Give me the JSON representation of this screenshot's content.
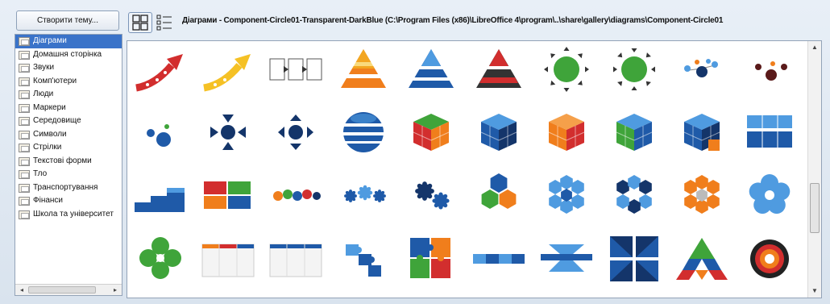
{
  "toolbar": {
    "create_theme_label": "Створити тему...",
    "path_text": "Діаграми - Component-Circle01-Transparent-DarkBlue (C:\\Program Files (x86)\\LibreOffice 4\\program\\..\\share\\gallery\\diagrams\\Component-Circle01"
  },
  "themes": [
    {
      "label": "Діаграми",
      "selected": true
    },
    {
      "label": "Домашня сторінка",
      "selected": false
    },
    {
      "label": "Звуки",
      "selected": false
    },
    {
      "label": "Комп'ютери",
      "selected": false
    },
    {
      "label": "Люди",
      "selected": false
    },
    {
      "label": "Маркери",
      "selected": false
    },
    {
      "label": "Середовище",
      "selected": false
    },
    {
      "label": "Символи",
      "selected": false
    },
    {
      "label": "Стрілки",
      "selected": false
    },
    {
      "label": "Текстові форми",
      "selected": false
    },
    {
      "label": "Тло",
      "selected": false
    },
    {
      "label": "Транспортування",
      "selected": false
    },
    {
      "label": "Фінанси",
      "selected": false
    },
    {
      "label": "Школа та університет",
      "selected": false
    }
  ],
  "gallery_items": [
    "arrow-red",
    "arrow-yellow",
    "process-boxes",
    "pyramid-orange",
    "pyramid-blue",
    "pyramid-red",
    "cycle-green-arrows-out",
    "cycle-green-arrows-in",
    "molecule-blue",
    "molecule-dark",
    "bubbles-blue",
    "cross-arrows-in",
    "cross-arrows-out",
    "sphere-stripes",
    "cube-multicolor",
    "cube-blue",
    "cube-orange",
    "cube-green",
    "cube-blue-stack",
    "blocks-blue",
    "steps-blue",
    "blocks-multicolor",
    "gears-chain",
    "gears-blue",
    "gears-pair",
    "hexagons-three",
    "hexagons-ring-blue",
    "hexagons-ring-navy",
    "hexagons-ring-orange",
    "petals-blue",
    "clover-green",
    "table-colored",
    "table-blue",
    "puzzle-blue",
    "puzzle-multicolor",
    "puzzle-chain",
    "crossing-blue",
    "square-blue",
    "triangle-multicolor",
    "target-circle"
  ],
  "colors": {
    "selection": "#3a73c9",
    "accent_blue": "#1f5aa8",
    "green": "#3fa43a",
    "orange": "#f07e1c",
    "red": "#d22e2e"
  }
}
